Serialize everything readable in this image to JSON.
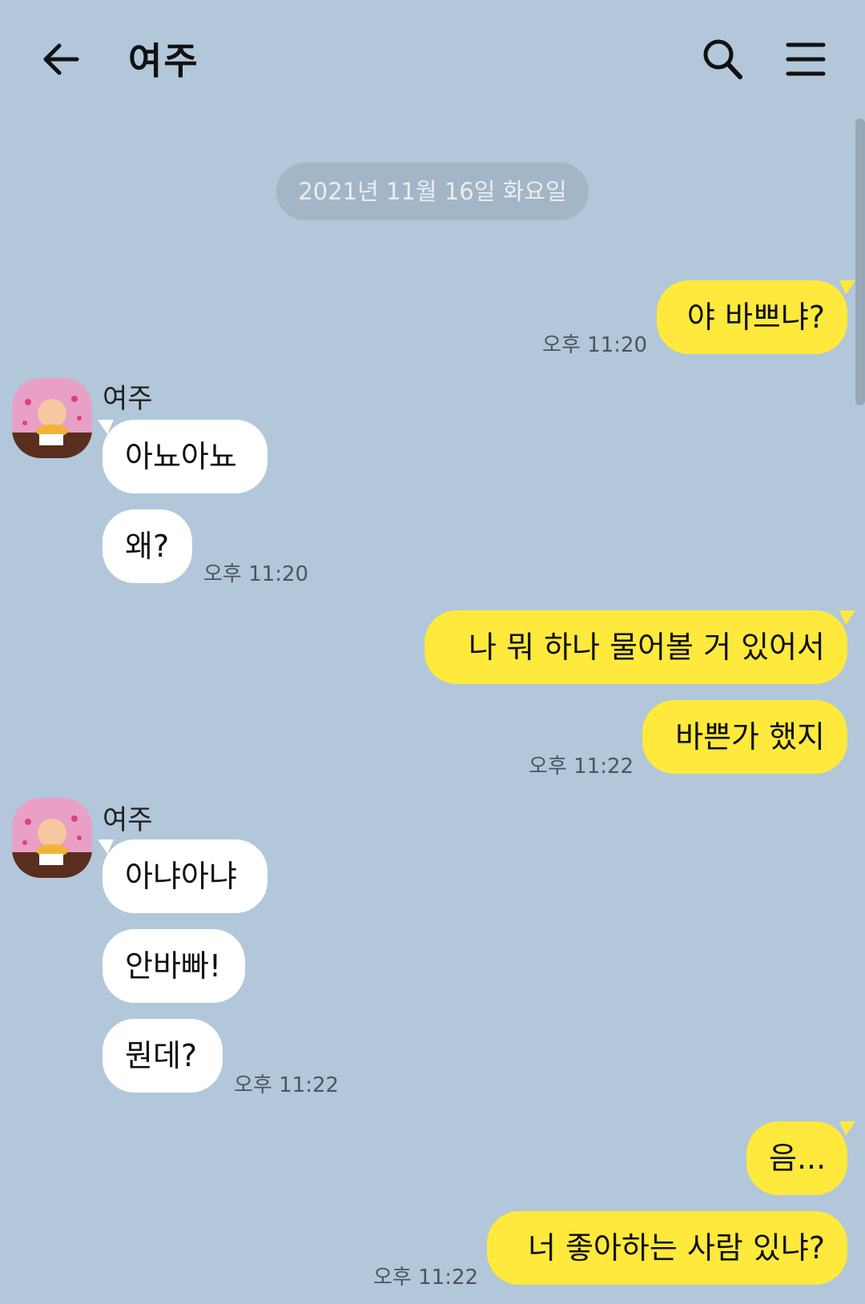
{
  "header": {
    "title": "여주",
    "back_icon": "arrow-left-icon",
    "search_icon": "search-icon",
    "menu_icon": "hamburger-menu-icon"
  },
  "date_divider": "2021년 11월 16일 화요일",
  "contact": {
    "name": "여주"
  },
  "messages": [
    {
      "from": "me",
      "text": "야 바쁘냐?",
      "time": "오후 11:20"
    },
    {
      "from": "them",
      "text": "아뇨아뇨"
    },
    {
      "from": "them",
      "text": "왜?",
      "time": "오후 11:20"
    },
    {
      "from": "me",
      "text": "나 뭐 하나 물어볼 거 있어서"
    },
    {
      "from": "me",
      "text": "바쁜가 했지",
      "time": "오후 11:22"
    },
    {
      "from": "them",
      "text": "아냐아냐"
    },
    {
      "from": "them",
      "text": "안바빠!"
    },
    {
      "from": "them",
      "text": "뭔데?",
      "time": "오후 11:22"
    },
    {
      "from": "me",
      "text": "음..."
    },
    {
      "from": "me",
      "text": "너 좋아하는 사람 있냐?",
      "time": "오후 11:22"
    }
  ],
  "colors": {
    "background": "#b2c7da",
    "my_bubble": "#fee93c",
    "their_bubble": "#ffffff",
    "date_pill": "#a3b6c7"
  }
}
